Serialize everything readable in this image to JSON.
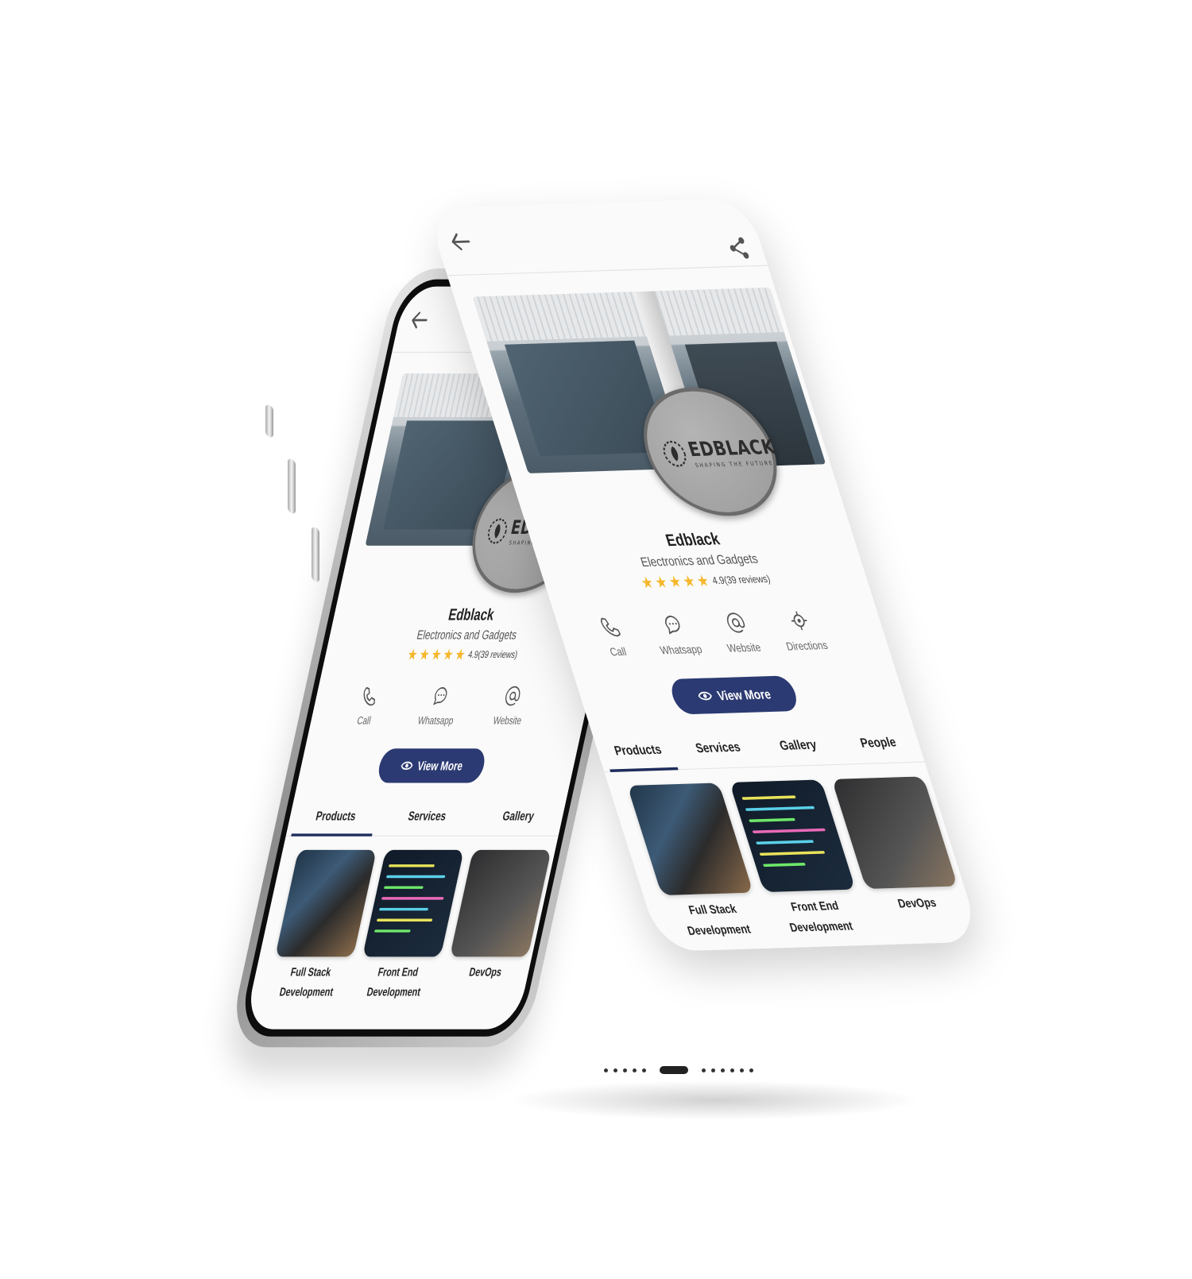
{
  "profile": {
    "name": "Edblack",
    "category": "Electronics and Gadgets",
    "rating_text": "4.9(39 reviews)",
    "rating_value": 4.9,
    "stars": 5,
    "logo_text": "EDBLACK",
    "logo_tagline": "SHAPING THE FUTURE"
  },
  "actions": [
    {
      "label": "Call",
      "icon": "phone-icon"
    },
    {
      "label": "Whatsapp",
      "icon": "chat-icon"
    },
    {
      "label": "Website",
      "icon": "at-icon"
    },
    {
      "label": "Directions",
      "icon": "location-target-icon"
    }
  ],
  "view_more_label": "View More",
  "tabs": [
    {
      "label": "Products",
      "active": true
    },
    {
      "label": "Services",
      "active": false
    },
    {
      "label": "Gallery",
      "active": false
    },
    {
      "label": "People",
      "active": false
    }
  ],
  "products": [
    {
      "title_line1": "Full Stack",
      "title_line2": "Development"
    },
    {
      "title_line1": "Front End",
      "title_line2": "Development"
    },
    {
      "title_line1": "DevOps",
      "title_line2": ""
    },
    {
      "title_line1": "",
      "title_line2": ""
    },
    {
      "title_line1": "",
      "title_line2": ""
    },
    {
      "title_line1": "",
      "title_line2": ""
    }
  ],
  "colors": {
    "accent": "#2b3a72",
    "tab_underline": "#1f2d5c",
    "star": "#f5b72c",
    "background": "#fafafa"
  }
}
